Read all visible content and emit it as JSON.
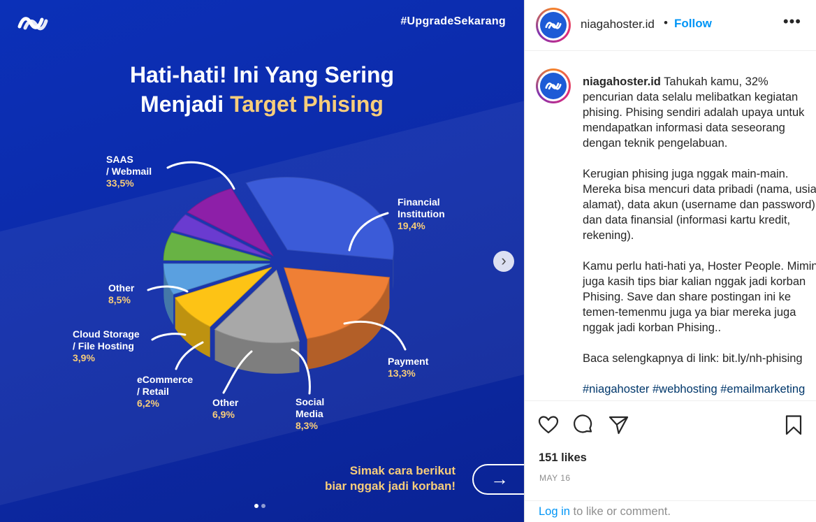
{
  "media": {
    "hashtag": "#UpgradeSekarang",
    "title_line1": "Hati-hati! Ini Yang Sering",
    "title_line2_prefix": "Menjadi ",
    "title_line2_highlight": "Target Phising",
    "cta_line1": "Simak cara berikut",
    "cta_line2": "biar nggak jadi korban!",
    "cta_arrow": "→",
    "next_arrow": "›",
    "colors": {
      "background": "#0d2aa7",
      "highlight": "#f7cd7a"
    }
  },
  "chart_data": {
    "type": "pie",
    "title": "Hati-hati! Ini Yang Sering Menjadi Target Phising",
    "slices": [
      {
        "label": "SAAS / Webmail",
        "label_lines": [
          "SAAS",
          "/ Webmail"
        ],
        "value": 33.5,
        "pct_text": "33,5%",
        "color": "#3b5bd8"
      },
      {
        "label": "Financial Institution",
        "label_lines": [
          "Financial",
          "Institution"
        ],
        "value": 19.4,
        "pct_text": "19,4%",
        "color": "#ef7f35"
      },
      {
        "label": "Payment",
        "label_lines": [
          "Payment"
        ],
        "value": 13.3,
        "pct_text": "13,3%",
        "color": "#a8a8a8"
      },
      {
        "label": "Social Media",
        "label_lines": [
          "Social",
          "Media"
        ],
        "value": 8.3,
        "pct_text": "8,3%",
        "color": "#fdc315"
      },
      {
        "label": "Other",
        "label_lines": [
          "Other"
        ],
        "value": 6.9,
        "pct_text": "6,9%",
        "color": "#5aa0e0"
      },
      {
        "label": "eCommerce / Retail",
        "label_lines": [
          "eCommerce",
          "/ Retail"
        ],
        "value": 6.2,
        "pct_text": "6,2%",
        "color": "#68b344"
      },
      {
        "label": "Cloud Storage / File Hosting",
        "label_lines": [
          "Cloud Storage",
          "/ File Hosting"
        ],
        "value": 3.9,
        "pct_text": "3,9%",
        "color": "#6a3bd0"
      },
      {
        "label": "Other",
        "label_lines": [
          "Other"
        ],
        "value": 8.5,
        "pct_text": "8,5%",
        "color": "#8d1fa8"
      }
    ]
  },
  "post": {
    "username": "niagahoster.id",
    "separator": "•",
    "follow_label": "Follow",
    "more_label": "•••",
    "caption_paragraphs": [
      "Tahukah kamu, 32% pencurian data selalu melibatkan kegiatan phising. Phising sendiri adalah upaya untuk mendapatkan informasi data seseorang dengan teknik pengelabuan.",
      "Kerugian phising juga nggak main-main. Mereka bisa mencuri data pribadi (nama, usia, alamat), data akun (username dan password), dan data finansial (informasi kartu kredit, rekening).",
      "Kamu perlu hati-hati ya, Hoster People. Mimin juga kasih tips biar kalian nggak jadi korban Phising. Save dan share postingan ini ke temen-temenmu juga ya biar mereka juga nggak jadi korban Phising..",
      "Baca selengkapnya di link: bit.ly/nh-phising"
    ],
    "hashtags": "#niagahoster #webhosting #emailmarketing",
    "likes": "151 likes",
    "date": "MAY 16",
    "login_link": "Log in",
    "login_suffix": " to like or comment."
  },
  "icons": {
    "like": "heart-icon",
    "comment": "comment-icon",
    "share": "paper-plane-icon",
    "save": "bookmark-icon"
  }
}
